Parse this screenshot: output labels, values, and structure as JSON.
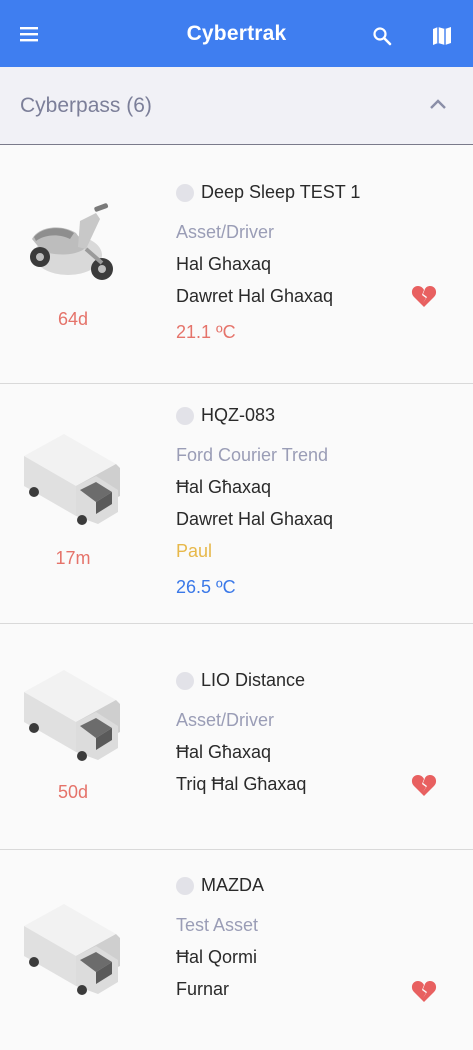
{
  "app": {
    "title": "Cybertrak",
    "menu_icon": "menu-icon",
    "search_icon": "search-icon",
    "map_icon": "map-icon",
    "brand_color": "#3f7ef0"
  },
  "group": {
    "label": "Cyberpass (6)",
    "expanded": true,
    "chevron_icon": "chevron-up-icon"
  },
  "items": [
    {
      "vehicle_icon": "scooter-icon",
      "age": "64d",
      "name": "Deep Sleep TEST 1",
      "line1": "Asset/Driver",
      "line2": "Hal Ghaxaq",
      "line3": "Dawret Hal Ghaxaq",
      "line4": "21.1 ºC",
      "line4_color": "#e5736a",
      "broken_heart": true
    },
    {
      "vehicle_icon": "truck-icon",
      "age": "17m",
      "name": "HQZ-083",
      "line1": "Ford Courier Trend",
      "line2": "Ħal Għaxaq",
      "line3": "Dawret Hal Ghaxaq",
      "line4": "Paul",
      "line4_color": "#e7b84a",
      "line5": "26.5 ºC",
      "line5_color": "#3a78e8",
      "broken_heart": false
    },
    {
      "vehicle_icon": "truck-icon",
      "age": "50d",
      "name": "LIO Distance",
      "line1": "Asset/Driver",
      "line2": "Ħal Għaxaq",
      "line3": "Triq Ħal Għaxaq",
      "broken_heart": true
    },
    {
      "vehicle_icon": "truck-icon",
      "age": "",
      "name": "MAZDA",
      "line1": "Test Asset",
      "line2": "Ħal Qormi",
      "line3": "Furnar",
      "broken_heart": true
    }
  ]
}
